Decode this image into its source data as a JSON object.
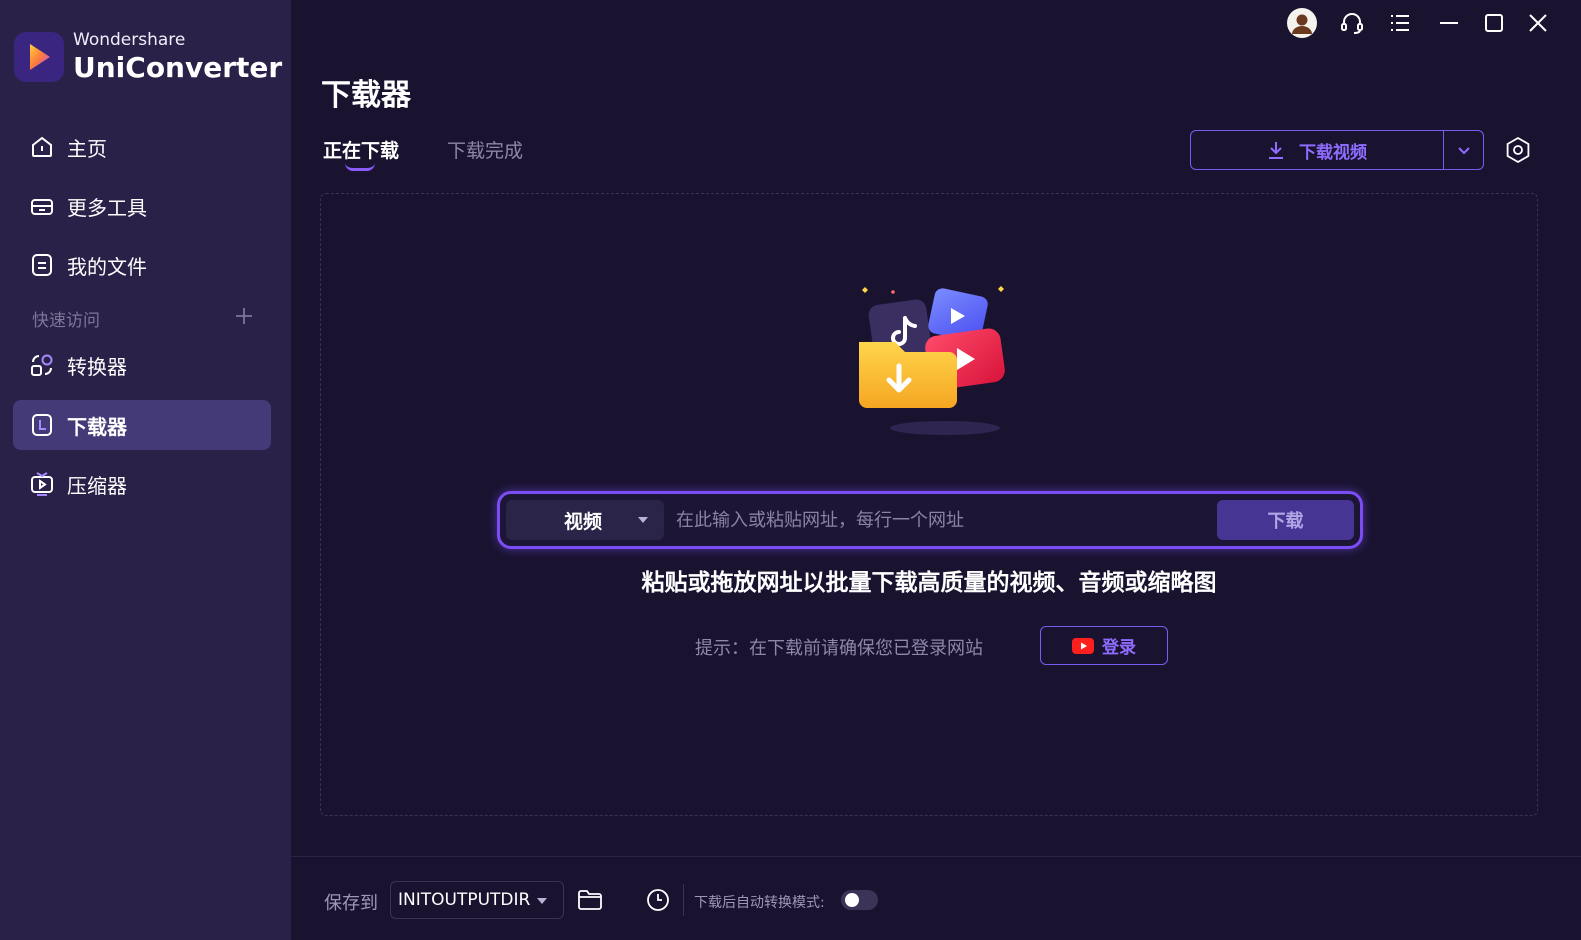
{
  "app": {
    "brand": "Wondershare",
    "product": "UniConverter"
  },
  "sidebar": {
    "items": [
      {
        "label": "主页",
        "icon": "home-icon"
      },
      {
        "label": "更多工具",
        "icon": "toolbox-icon"
      },
      {
        "label": "我的文件",
        "icon": "file-icon"
      }
    ],
    "quick_access_label": "快速访问",
    "quick_items": [
      {
        "label": "转换器",
        "icon": "converter-icon"
      },
      {
        "label": "下载器",
        "icon": "downloader-icon",
        "active": true
      },
      {
        "label": "压缩器",
        "icon": "compressor-icon"
      }
    ]
  },
  "topbar": {
    "icons": [
      "avatar-icon",
      "headset-icon",
      "menu-icon",
      "minimize-icon",
      "maximize-icon",
      "close-icon"
    ]
  },
  "main": {
    "title": "下载器",
    "tabs": [
      {
        "label": "正在下载",
        "active": true
      },
      {
        "label": "下载完成",
        "active": false
      }
    ],
    "download_video_label": "下载视频",
    "url_box": {
      "type_selected": "视频",
      "placeholder": "在此输入或粘贴网址，每行一个网址",
      "submit_label": "下载"
    },
    "headline": "粘贴或拖放网址以批量下载高质量的视频、音频或缩略图",
    "hint": "提示：在下载前请确保您已登录网站",
    "login_label": "登录"
  },
  "footer": {
    "save_to_label": "保存到",
    "output_dir": "INITOUTPUTDIR",
    "auto_convert_label": "下载后自动转换模式:",
    "auto_convert_on": false
  },
  "colors": {
    "background": "#1a1330",
    "sidebar": "#2a2148",
    "accent": "#7b4df5",
    "active_item": "#453a78"
  }
}
